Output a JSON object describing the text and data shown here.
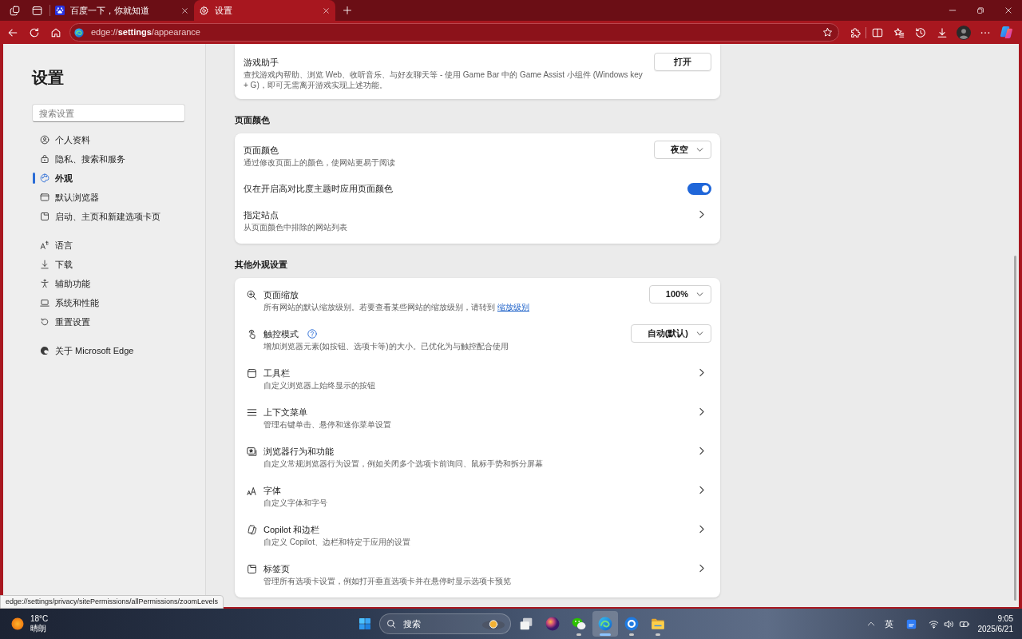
{
  "browser": {
    "tabs": [
      {
        "title": "百度一下，你就知道",
        "selected": false
      },
      {
        "title": "设置",
        "selected": true
      }
    ],
    "address": "edge://**settings**/appearance",
    "status_url": "edge://settings/privacy/sitePermissions/allPermissions/zoomLevels"
  },
  "sidebar": {
    "title": "设置",
    "search": {
      "placeholder": "搜索设置"
    },
    "groups": [
      {
        "items": [
          {
            "label": "个人资料",
            "selected": false
          },
          {
            "label": "隐私、搜索和服务",
            "selected": false
          },
          {
            "label": "外观",
            "selected": true
          },
          {
            "label": "默认浏览器",
            "selected": false
          },
          {
            "label": "启动、主页和新建选项卡页",
            "selected": false
          }
        ]
      },
      {
        "items": [
          {
            "label": "语言",
            "selected": false
          },
          {
            "label": "下载",
            "selected": false
          },
          {
            "label": "辅助功能",
            "selected": false
          },
          {
            "label": "系统和性能",
            "selected": false
          },
          {
            "label": "重置设置",
            "selected": false
          }
        ]
      },
      {
        "items": [
          {
            "label": "关于 Microsoft Edge",
            "selected": false
          }
        ]
      }
    ]
  },
  "content": {
    "sections": [
      {
        "rows": [
          {
            "kind": "button",
            "title": "游戏助手",
            "description": "查找游戏内帮助、浏览 Web、收听音乐、与好友聊天等 - 使用 Game Bar 中的 Game Assist 小组件 (Windows key + G)，即可无需离开游戏实现上述功能。",
            "button": "打开"
          }
        ]
      },
      {
        "heading": "页面颜色",
        "rows": [
          {
            "kind": "dropdown",
            "title": "页面颜色",
            "description": "通过修改页面上的颜色，使网站更易于阅读",
            "value": "夜空"
          },
          {
            "kind": "toggle",
            "title": "仅在开启高对比度主题时应用页面颜色",
            "on": true
          },
          {
            "kind": "link",
            "title": "指定站点",
            "description": "从页面颜色中排除的网站列表"
          }
        ]
      },
      {
        "heading": "其他外观设置",
        "with_icons": true,
        "rows": [
          {
            "kind": "dropdown",
            "title": "页面缩放",
            "description": "所有网站的默认缩放级别。若要查看某些网站的缩放级别，请转到",
            "link": "缩放级别",
            "value": "100%"
          },
          {
            "kind": "dropdown",
            "title": "触控模式",
            "help_icon": true,
            "description": "增加浏览器元素(如按钮、选项卡等)的大小。已优化为与触控配合使用",
            "value": "自动(默认)"
          },
          {
            "kind": "link",
            "title": "工具栏",
            "description": "自定义浏览器上始终显示的按钮"
          },
          {
            "kind": "link",
            "title": "上下文菜单",
            "description": "管理右键单击、悬停和迷你菜单设置"
          },
          {
            "kind": "link",
            "title": "浏览器行为和功能",
            "description": "自定义常规浏览器行为设置，例如关闭多个选项卡前询问、鼠标手势和拆分屏幕"
          },
          {
            "kind": "link",
            "title": "字体",
            "description": "自定义字体和字号"
          },
          {
            "kind": "link",
            "title": "Copilot 和边栏",
            "description": "自定义 Copilot、边栏和特定于应用的设置"
          },
          {
            "kind": "link",
            "title": "标签页",
            "description": "管理所有选项卡设置，例如打开垂直选项卡并在悬停时显示选项卡预览"
          }
        ]
      }
    ]
  },
  "taskbar": {
    "weather": {
      "temperature": "18°C",
      "condition": "晴朗"
    },
    "search": {
      "label": "搜索"
    },
    "apps": [
      {
        "running": false,
        "selected": false
      },
      {
        "running": false,
        "selected": false
      },
      {
        "running": true,
        "selected": false
      },
      {
        "running": true,
        "selected": true
      },
      {
        "running": true,
        "selected": false
      },
      {
        "running": true,
        "selected": false
      }
    ],
    "input_language": "英",
    "clock": {
      "time": "9:05",
      "date": "2025/6/21"
    }
  }
}
